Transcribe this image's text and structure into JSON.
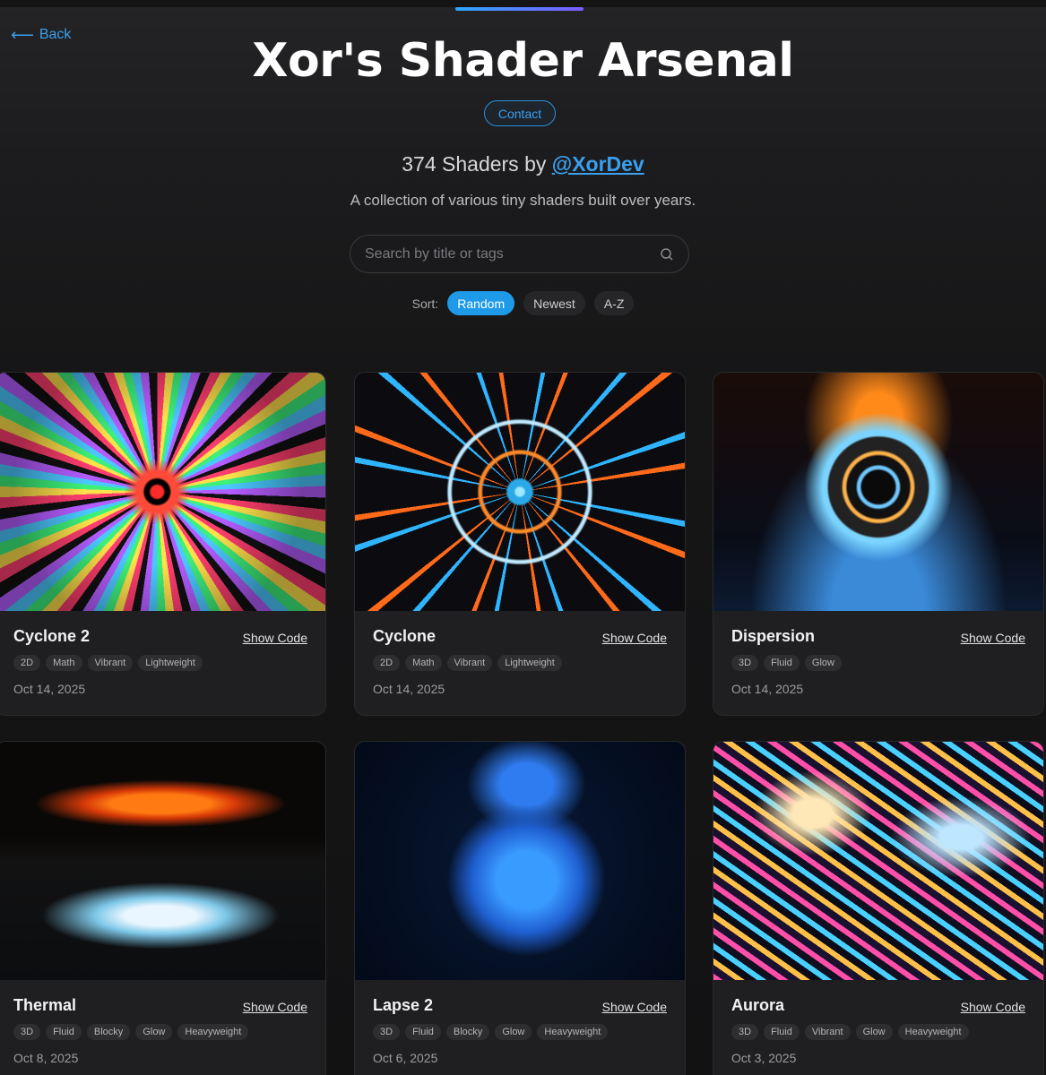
{
  "header": {
    "back_label": "Back",
    "title": "Xor's Shader Arsenal",
    "contact_label": "Contact",
    "count_text": "374 Shaders by ",
    "author_handle": "@XorDev",
    "tagline": "A collection of various tiny shaders built over years."
  },
  "search": {
    "placeholder": "Search by title or tags",
    "value": ""
  },
  "sort": {
    "label": "Sort:",
    "options": [
      "Random",
      "Newest",
      "A-Z"
    ],
    "selected": "Random"
  },
  "cards": [
    {
      "title": "Cyclone 2",
      "show_code": "Show Code",
      "tags": [
        "2D",
        "Math",
        "Vibrant",
        "Lightweight"
      ],
      "date": "Oct 14, 2025"
    },
    {
      "title": "Cyclone",
      "show_code": "Show Code",
      "tags": [
        "2D",
        "Math",
        "Vibrant",
        "Lightweight"
      ],
      "date": "Oct 14, 2025"
    },
    {
      "title": "Dispersion",
      "show_code": "Show Code",
      "tags": [
        "3D",
        "Fluid",
        "Glow"
      ],
      "date": "Oct 14, 2025"
    },
    {
      "title": "Thermal",
      "show_code": "Show Code",
      "tags": [
        "3D",
        "Fluid",
        "Blocky",
        "Glow",
        "Heavyweight"
      ],
      "date": "Oct 8, 2025"
    },
    {
      "title": "Lapse 2",
      "show_code": "Show Code",
      "tags": [
        "3D",
        "Fluid",
        "Blocky",
        "Glow",
        "Heavyweight"
      ],
      "date": "Oct 6, 2025"
    },
    {
      "title": "Aurora",
      "show_code": "Show Code",
      "tags": [
        "3D",
        "Fluid",
        "Vibrant",
        "Glow",
        "Heavyweight"
      ],
      "date": "Oct 3, 2025"
    }
  ],
  "colors": {
    "accent": "#1e9ae8",
    "link": "#3aa0f0",
    "background": "#161617",
    "card": "#1f1f21"
  },
  "icons": {
    "back": "arrow-left-icon",
    "search": "search-icon"
  }
}
